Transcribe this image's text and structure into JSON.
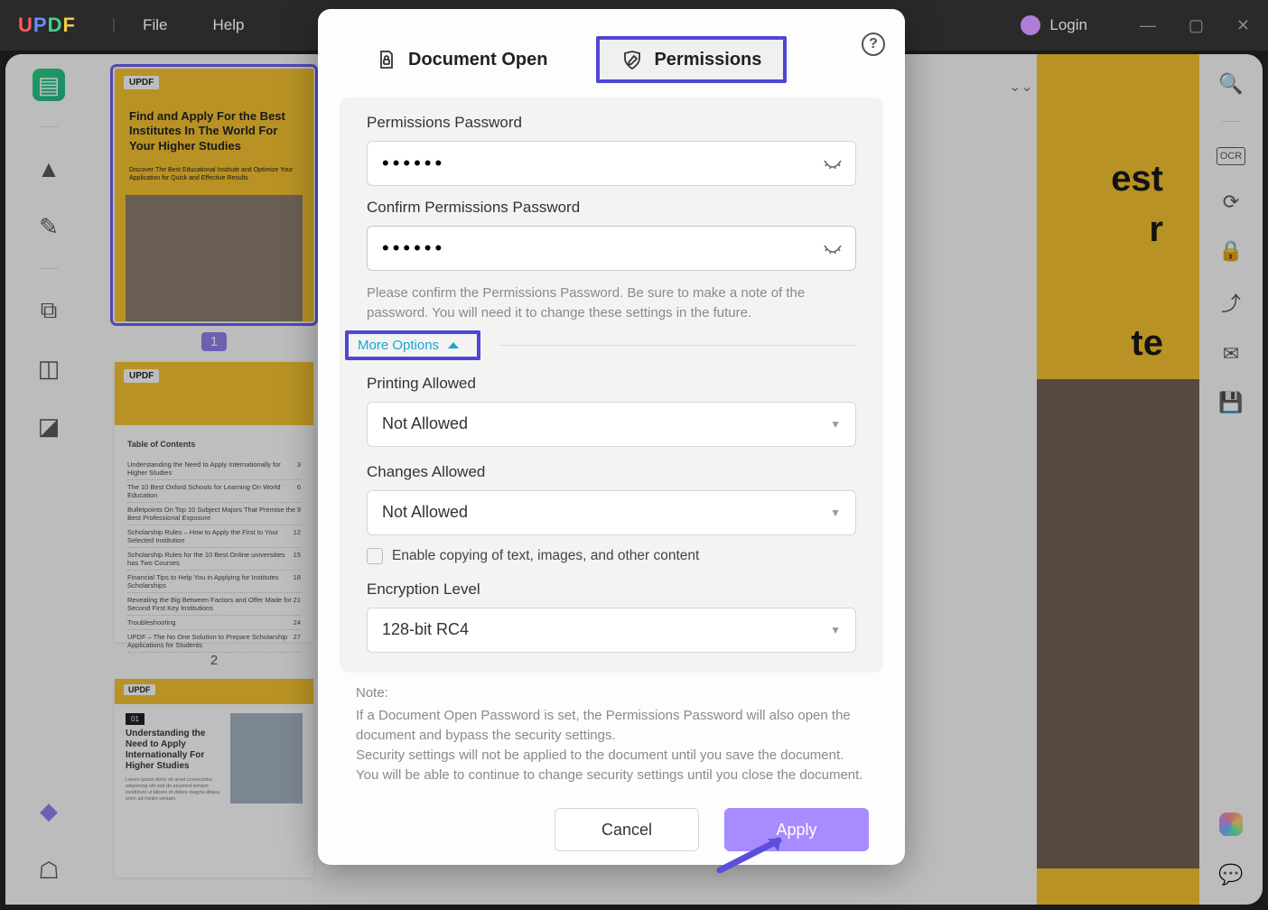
{
  "menubar": {
    "file": "File",
    "help": "Help",
    "login": "Login"
  },
  "dialog": {
    "tab_document_open": "Document Open",
    "tab_permissions": "Permissions",
    "perm_pw_label": "Permissions Password",
    "perm_pw_value": "••••••",
    "confirm_pw_label": "Confirm Permissions Password",
    "confirm_pw_value": "••••••",
    "confirm_hint": "Please confirm the Permissions Password. Be sure to make a note of the password. You will need it to change these settings in the future.",
    "more_options": "More Options",
    "printing_label": "Printing Allowed",
    "printing_value": "Not Allowed",
    "changes_label": "Changes Allowed",
    "changes_value": "Not Allowed",
    "copy_checkbox": "Enable copying of text, images, and other content",
    "encryption_label": "Encryption Level",
    "encryption_value": "128-bit RC4",
    "note_label": "Note:",
    "note1": "If a Document Open Password is set, the Permissions Password will also open the document and bypass the security settings.",
    "note2": "Security settings will not be applied to the document until you save the document. You will be able to continue to change security settings until you close the document.",
    "cancel": "Cancel",
    "apply": "Apply"
  },
  "thumbs": {
    "brand": "UPDF",
    "t1_title": "Find and Apply For the Best Institutes In The World For Your Higher Studies",
    "t1_sub": "Discover The Best Educational Institute and Optimize Your Application for Quick and Effective Results",
    "toc_title": "Table of Contents",
    "toc_rows": [
      "Understanding the Need to Apply Internationally for Higher Studies",
      "The 10 Best Oxford Schools for Learning On World Education",
      "Bulletpoints On Top 10 Subject Majors That Premise the Best Professional Exposure",
      "Scholarship Rules – How to Apply the First to Your Selected Institution",
      "Scholarship Rules for the 10 Best Online universities has Two Courses",
      "Financial Tips to Help You in Applying for Institutes Scholarships",
      "Revealing the Big Between Factors and Offer Made for Second First Key Institutions",
      "Troubleshooting",
      "UPDF – The No One Solution to Prepare Scholarship Applications for Students"
    ],
    "t3_badge": "01",
    "t3_title": "Understanding the Need to Apply Internationally For Higher Studies",
    "page1": "1",
    "page2": "2"
  },
  "bg_title_lines": [
    "est",
    "r",
    "te"
  ]
}
